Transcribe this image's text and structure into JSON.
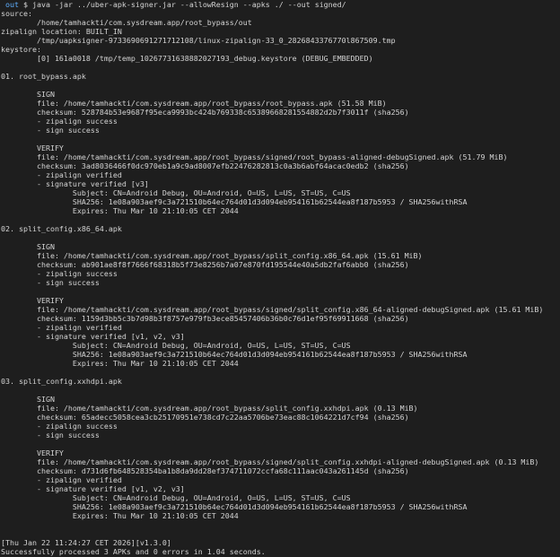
{
  "prompt": {
    "icon": "",
    "cwd": "out",
    "symbol": "$",
    "command": "java -jar ../uber-apk-signer.jar --allowResign --apks ./ --out signed/"
  },
  "lines": [
    "source:",
    "        /home/tamhackti/com.sysdream.app/root_bypass/out",
    "zipalign location: BUILT_IN",
    "        /tmp/uapksigner-9733690691271712108/linux-zipalign-33_0_2826843376770l867509.tmp",
    "keystore:",
    "        [0] 161a0018 /tmp/temp_10267731638882027193_debug.keystore (DEBUG_EMBEDDED)",
    "",
    "01. root_bypass.apk",
    "",
    "        SIGN",
    "        file: /home/tamhackti/com.sysdream.app/root_bypass/root_bypass.apk (51.58 MiB)",
    "        checksum: 528784b53e9687f95eca9993bc424b769338c65389668281554882d2b7f3011f (sha256)",
    "        - zipalign success",
    "        - sign success",
    "",
    "        VERIFY",
    "        file: /home/tamhackti/com.sysdream.app/root_bypass/signed/root_bypass-aligned-debugSigned.apk (51.79 MiB)",
    "        checksum: 3ad8036466f0dc970eb1a9c9ad8007efb22476282813c0a3b6abf64acac0edb2 (sha256)",
    "        - zipalign verified",
    "        - signature verified [v3]",
    "                Subject: CN=Android Debug, OU=Android, O=US, L=US, ST=US, C=US",
    "                SHA256: 1e08a903aef9c3a721510b64ec764d01d3d094eb954161b62544ea8f187b5953 / SHA256withRSA",
    "                Expires: Thu Mar 10 21:10:05 CET 2044",
    "",
    "02. split_config.x86_64.apk",
    "",
    "        SIGN",
    "        file: /home/tamhackti/com.sysdream.app/root_bypass/split_config.x86_64.apk (15.61 MiB)",
    "        checksum: ab901ae8f8f7666f68318b5f73e8256b7a07e870fd195544e40a5db2faf6abb0 (sha256)",
    "        - zipalign success",
    "        - sign success",
    "",
    "        VERIFY",
    "        file: /home/tamhackti/com.sysdream.app/root_bypass/signed/split_config.x86_64-aligned-debugSigned.apk (15.61 MiB)",
    "        checksum: 1159d3bb5c3b7d98b3f8757e979fb3ece85457406b36b0c76d1ef95f69911668 (sha256)",
    "        - zipalign verified",
    "        - signature verified [v1, v2, v3]",
    "                Subject: CN=Android Debug, OU=Android, O=US, L=US, ST=US, C=US",
    "                SHA256: 1e08a903aef9c3a721510b64ec764d01d3d094eb954161b62544ea8f187b5953 / SHA256withRSA",
    "                Expires: Thu Mar 10 21:10:05 CET 2044",
    "",
    "03. split_config.xxhdpi.apk",
    "",
    "        SIGN",
    "        file: /home/tamhackti/com.sysdream.app/root_bypass/split_config.xxhdpi.apk (0.13 MiB)",
    "        checksum: 65adecc5058cea3cb25170951e738cd7c22aa5706be73eac88c1064221d7cf94 (sha256)",
    "        - zipalign success",
    "        - sign success",
    "",
    "        VERIFY",
    "        file: /home/tamhackti/com.sysdream.app/root_bypass/signed/split_config.xxhdpi-aligned-debugSigned.apk (0.13 MiB)",
    "        checksum: d731d6fb648528354ba1b8da9dd28ef374711072ccfa68c111aac043a261145d (sha256)",
    "        - zipalign verified",
    "        - signature verified [v1, v2, v3]",
    "                Subject: CN=Android Debug, OU=Android, O=US, L=US, ST=US, C=US",
    "                SHA256: 1e08a903aef9c3a721510b64ec764d01d3d094eb954161b62544ea8f187b5953 / SHA256withRSA",
    "                Expires: Thu Mar 10 21:10:05 CET 2044",
    "",
    "",
    "[Thu Jan 22 11:24:27 CET 2026][v1.3.0]",
    "Successfully processed 3 APKs and 0 errors in 1.04 seconds."
  ]
}
